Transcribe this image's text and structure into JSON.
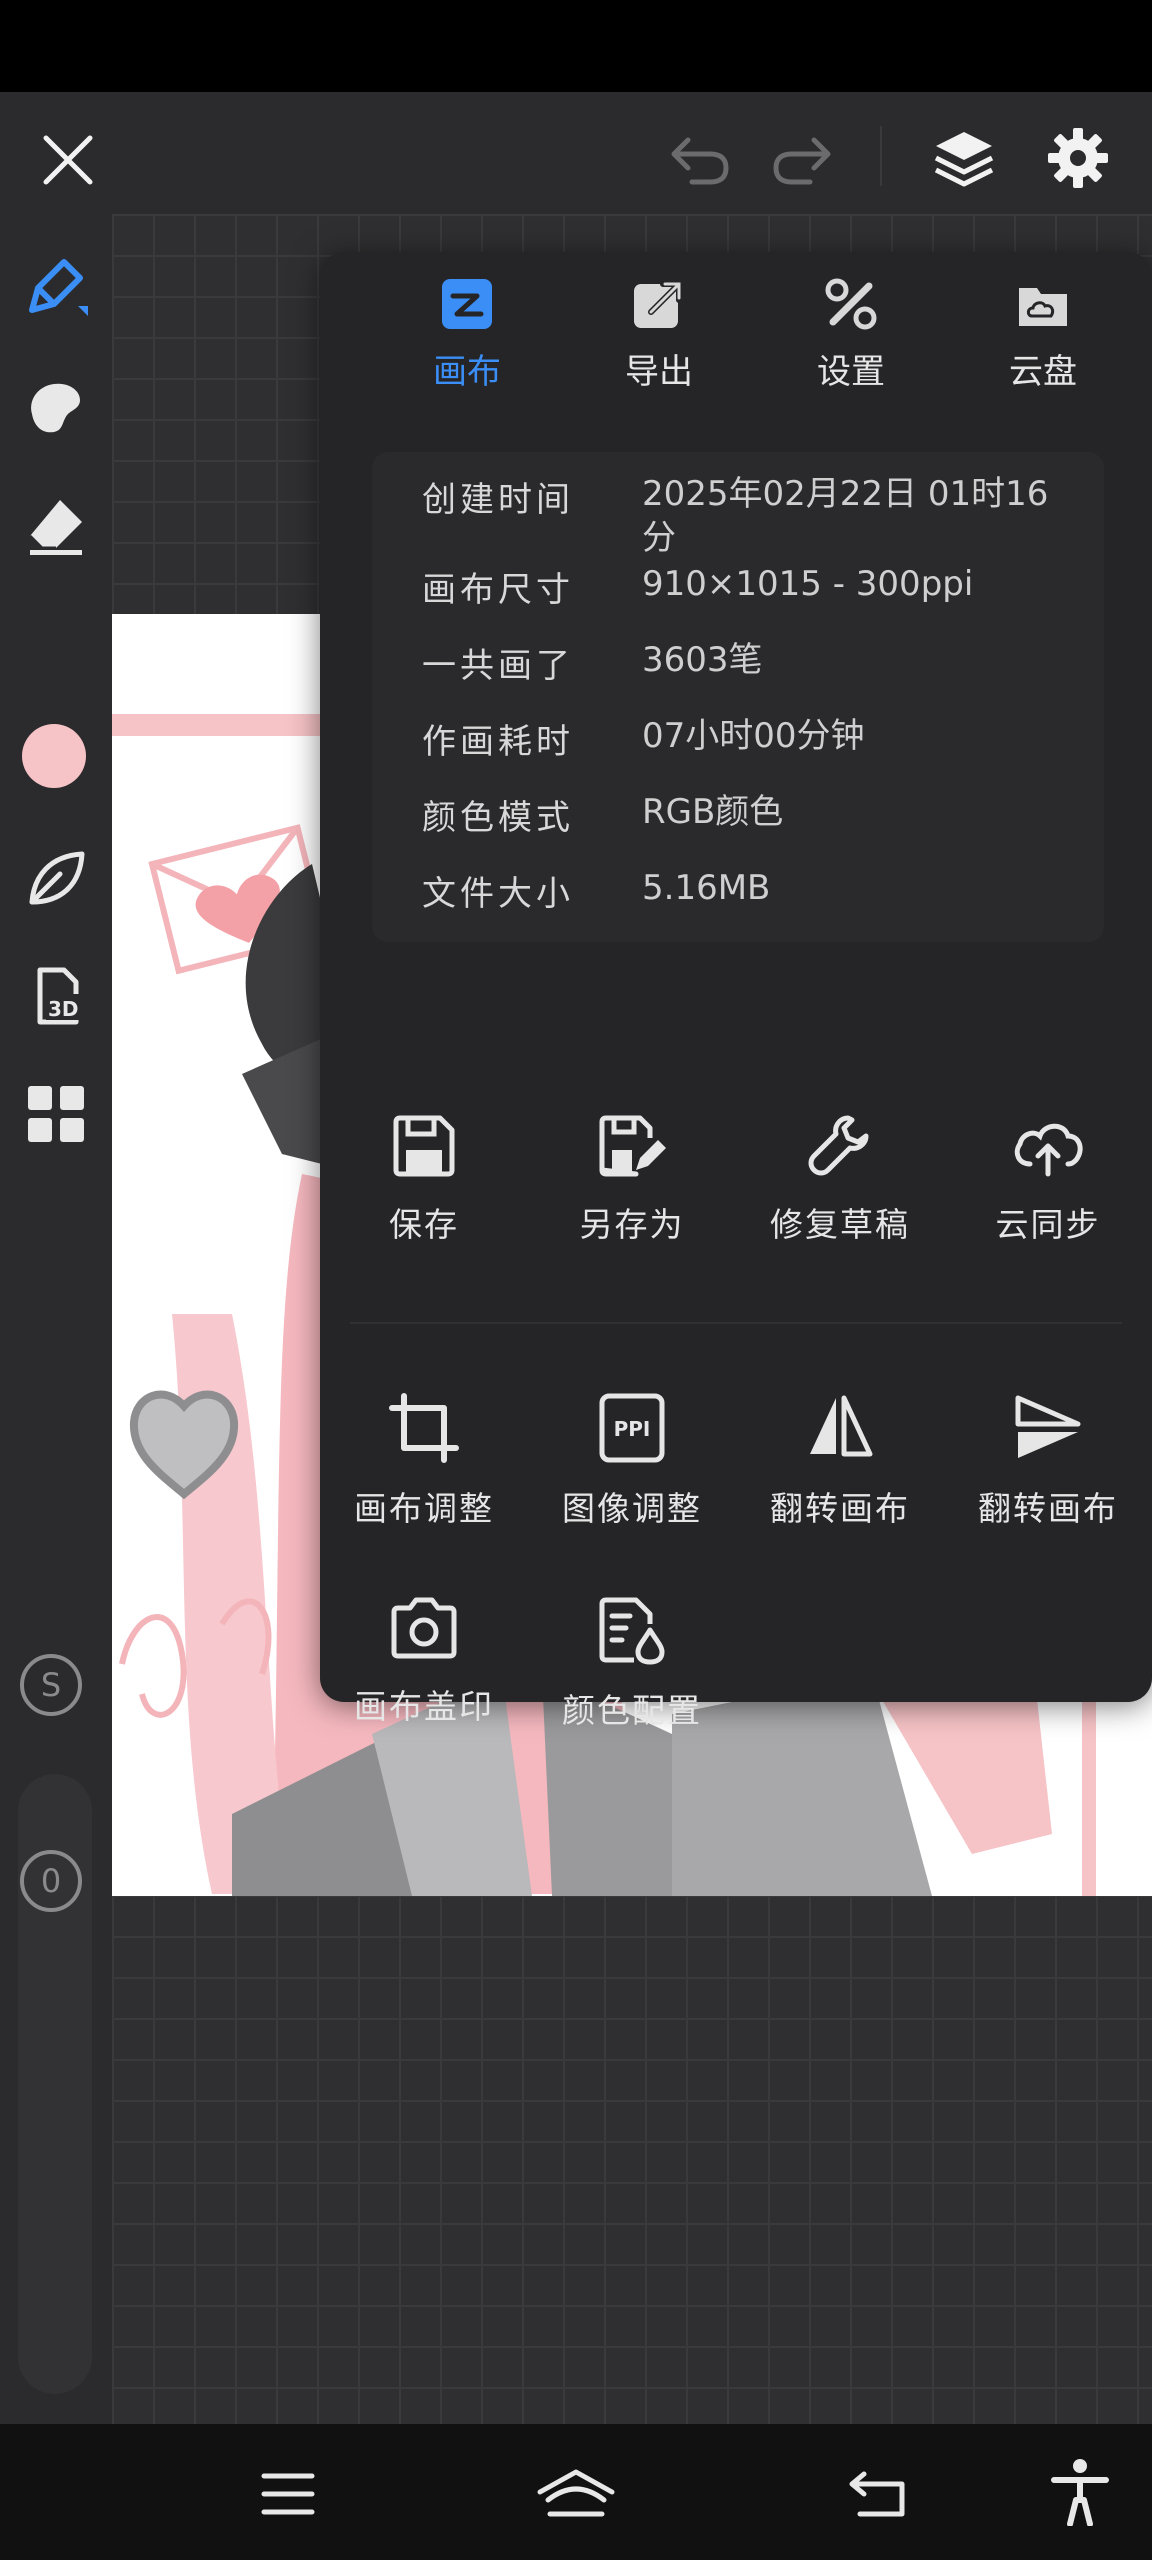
{
  "toolbar": {
    "close_icon": "close-icon",
    "undo_icon": "undo-icon",
    "redo_icon": "redo-icon",
    "layers_icon": "layers-icon",
    "settings_icon": "gear-icon"
  },
  "sidebar": {
    "tools": [
      "pen-icon",
      "smudge-icon",
      "eraser-icon",
      "color-swatch",
      "leaf-icon",
      "3d-icon",
      "grid-icon"
    ],
    "brush_color": "#f6c3c6",
    "size_label": "S",
    "opacity_label": "0"
  },
  "panel": {
    "tabs": [
      {
        "label": "画布",
        "icon": "canvas-icon",
        "active": true
      },
      {
        "label": "导出",
        "icon": "export-icon",
        "active": false
      },
      {
        "label": "设置",
        "icon": "tools-icon",
        "active": false
      },
      {
        "label": "云盘",
        "icon": "cloud-drive-icon",
        "active": false
      }
    ],
    "info": [
      {
        "key": "创建时间",
        "value": "2025年02月22日 01时16分"
      },
      {
        "key": "画布尺寸",
        "value": "910×1015 - 300ppi"
      },
      {
        "key": "一共画了",
        "value": "3603笔"
      },
      {
        "key": "作画耗时",
        "value": "07小时00分钟"
      },
      {
        "key": "颜色模式",
        "value": "RGB颜色"
      },
      {
        "key": "文件大小",
        "value": "5.16MB"
      }
    ],
    "actions_row1": [
      {
        "label": "保存",
        "icon": "save-icon"
      },
      {
        "label": "另存为",
        "icon": "save-as-icon"
      },
      {
        "label": "修复草稿",
        "icon": "wrench-icon"
      },
      {
        "label": "云同步",
        "icon": "cloud-sync-icon"
      }
    ],
    "actions_row2": [
      {
        "label": "画布调整",
        "icon": "crop-icon"
      },
      {
        "label": "图像调整",
        "icon": "ppi-icon",
        "icon_text": "PPI"
      },
      {
        "label": "翻转画布",
        "icon": "flip-horizontal-icon"
      },
      {
        "label": "翻转画布",
        "icon": "flip-vertical-icon"
      }
    ],
    "actions_row3": [
      {
        "label": "画布盖印",
        "icon": "camera-icon"
      },
      {
        "label": "颜色配置",
        "icon": "color-profile-icon"
      }
    ]
  },
  "colors": {
    "accent": "#3a8ef5",
    "panel_bg": "#252528",
    "app_bg": "#2b2b2d"
  },
  "navbar": [
    "menu-icon",
    "home-icon",
    "back-icon",
    "accessibility-icon"
  ]
}
